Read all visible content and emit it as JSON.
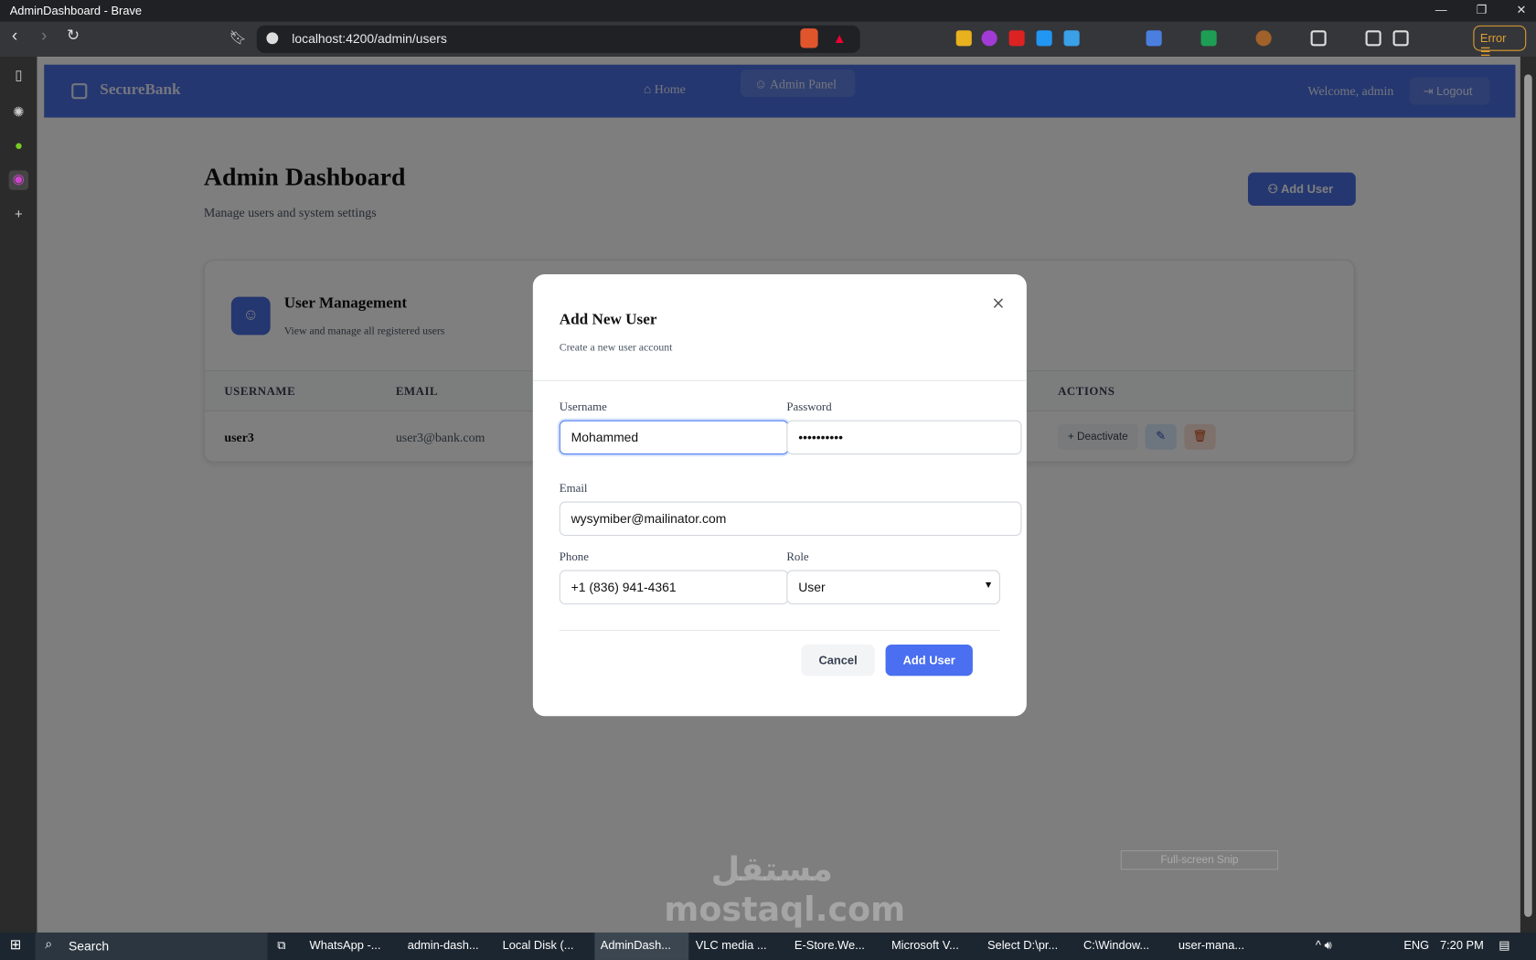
{
  "browser": {
    "window_title": "AdminDashboard - Brave",
    "url": "localhost:4200/admin/users",
    "error_label": "Error"
  },
  "app": {
    "brand": "SecureBank",
    "nav": [
      {
        "label": "Home"
      },
      {
        "label": "Admin Panel"
      }
    ],
    "welcome": "Welcome, admin",
    "logout": "Logout"
  },
  "dashboard": {
    "title": "Admin Dashboard",
    "subtitle": "Manage users and system settings",
    "add_user": "Add User"
  },
  "users_card": {
    "title": "User Management",
    "subtitle": "View and manage all registered users",
    "columns": [
      "USERNAME",
      "EMAIL",
      "ACTIONS"
    ],
    "rows": [
      {
        "username": "user3",
        "email": "user3@bank.com",
        "deactivate": "Deactivate"
      }
    ]
  },
  "modal": {
    "title": "Add New User",
    "subtitle": "Create a new user account",
    "username_label": "Username",
    "username_value": "Mohammed",
    "password_label": "Password",
    "password_value": "••••••••••",
    "email_label": "Email",
    "email_value": "wysymiber@mailinator.com",
    "phone_label": "Phone",
    "phone_value": "+1 (836) 941-4361",
    "role_label": "Role",
    "role_value": "User",
    "cancel": "Cancel",
    "submit": "Add User"
  },
  "snip": "Full-screen Snip",
  "watermark": "مستقل mostaql.com",
  "taskbar": {
    "search": "Search",
    "apps": [
      "WhatsApp -...",
      "admin-dash...",
      "Local Disk (...",
      "AdminDash...",
      "VLC media ...",
      "E-Store.We...",
      "Microsoft V...",
      "Select D:\\pr...",
      "C:\\Window...",
      "user-mana..."
    ],
    "lang": "ENG",
    "time": "7:20 PM"
  }
}
